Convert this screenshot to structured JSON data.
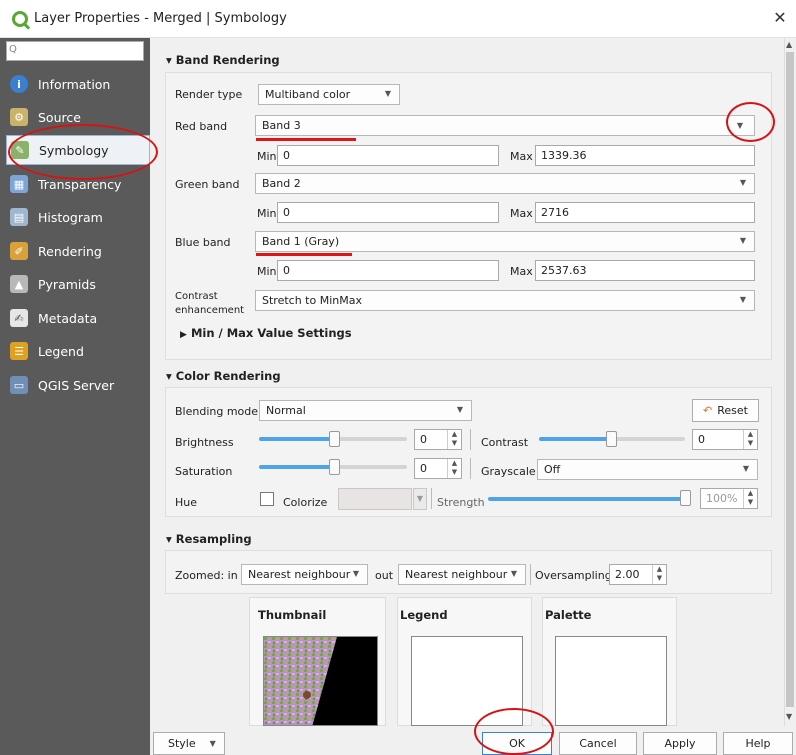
{
  "window": {
    "title": "Layer Properties - Merged | Symbology",
    "close_glyph": "✕"
  },
  "sidebar": {
    "search_placeholder": "Q",
    "items": [
      {
        "label": "Information",
        "icon": "info-icon"
      },
      {
        "label": "Source",
        "icon": "source-icon"
      },
      {
        "label": "Symbology",
        "icon": "paintbrush-icon"
      },
      {
        "label": "Transparency",
        "icon": "transparency-icon"
      },
      {
        "label": "Histogram",
        "icon": "histogram-icon"
      },
      {
        "label": "Rendering",
        "icon": "rendering-brush-icon"
      },
      {
        "label": "Pyramids",
        "icon": "pyramids-icon"
      },
      {
        "label": "Metadata",
        "icon": "metadata-icon"
      },
      {
        "label": "Legend",
        "icon": "legend-icon"
      },
      {
        "label": "QGIS Server",
        "icon": "server-icon"
      }
    ],
    "active": "Symbology"
  },
  "band_rendering": {
    "title": "Band Rendering",
    "render_type_label": "Render type",
    "render_type": "Multiband color",
    "red_label": "Red band",
    "red_value": "Band 3",
    "red_min_label": "Min",
    "red_min": "0",
    "red_max_label": "Max",
    "red_max": "1339.36",
    "green_label": "Green band",
    "green_value": "Band 2",
    "green_min_label": "Min",
    "green_min": "0",
    "green_max_label": "Max",
    "green_max": "2716",
    "blue_label": "Blue band",
    "blue_value": "Band 1 (Gray)",
    "blue_min_label": "Min",
    "blue_min": "0",
    "blue_max_label": "Max",
    "blue_max": "2537.63",
    "contrast_label_1": "Contrast",
    "contrast_label_2": "enhancement",
    "contrast_value": "Stretch to MinMax",
    "minmax_settings": "Min / Max Value Settings"
  },
  "color_rendering": {
    "title": "Color Rendering",
    "blending_label": "Blending mode",
    "blending_value": "Normal",
    "reset_label": "Reset",
    "brightness_label": "Brightness",
    "brightness_value": "0",
    "brightness_level": 0.5,
    "contrast_label": "Contrast",
    "contrast_value": "0",
    "contrast_level": 0.5,
    "saturation_label": "Saturation",
    "saturation_value": "0",
    "saturation_level": 0.5,
    "grayscale_label": "Grayscale",
    "grayscale_value": "Off",
    "hue_label": "Hue",
    "colorize_label": "Colorize",
    "strength_label": "Strength",
    "strength_value": "100%",
    "strength_level": 1.0
  },
  "resampling": {
    "title": "Resampling",
    "zoomed_in_label": "Zoomed: in",
    "zoomed_in_value": "Nearest neighbour",
    "out_label": "out",
    "zoomed_out_value": "Nearest neighbour",
    "oversampling_label": "Oversampling",
    "oversampling_value": "2.00"
  },
  "previews": {
    "thumbnail_label": "Thumbnail",
    "legend_label": "Legend",
    "palette_label": "Palette"
  },
  "buttons": {
    "style": "Style",
    "ok": "OK",
    "cancel": "Cancel",
    "apply": "Apply",
    "help": "Help"
  },
  "colors": {
    "sidebar_bg": "#5a5a5a",
    "annotation_red": "#d41414",
    "slider_blue": "#4ea4e8"
  }
}
